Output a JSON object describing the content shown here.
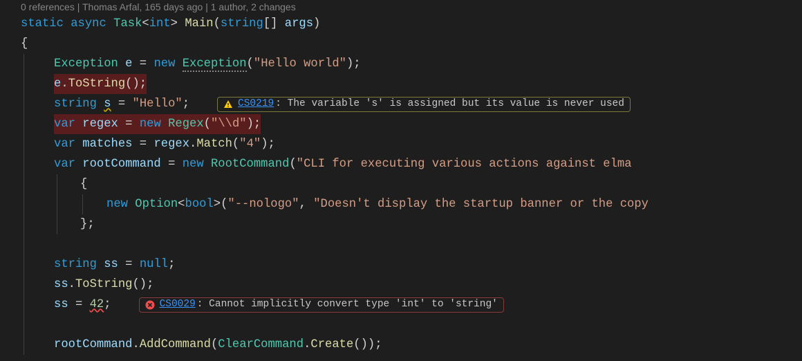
{
  "codelens": "0 references | Thomas Arfal, 165 days ago | 1 author, 2 changes",
  "sig": {
    "static": "static",
    "async": "async",
    "task": "Task",
    "lt": "<",
    "int": "int",
    "gt": ">",
    "sp": " ",
    "main": "Main",
    "op": "(",
    "string": "string",
    "br": "[] ",
    "args": "args",
    "cp": ")"
  },
  "openBrace": "{",
  "l1": {
    "type": "Exception",
    "v": "e",
    "eq": " = ",
    "new": "new",
    "ctor": "Exception",
    "op": "(",
    "str": "\"Hello world\"",
    "cp": ");"
  },
  "l2": {
    "v": "e",
    "dot": ".",
    "m": "ToString",
    "end": "();"
  },
  "l3": {
    "kw": "string",
    "v": "s",
    "eq": " = ",
    "str": "\"Hello\"",
    "end": ";"
  },
  "diag1": {
    "code": "CS0219",
    "msg": ": The variable 's' is assigned but its value is never used"
  },
  "l4": {
    "kw": "var",
    "v": "regex",
    "eq": " = ",
    "new": "new",
    "ctor": "Regex",
    "op": "(",
    "str": "\"\\\\d\"",
    "cp": ");"
  },
  "l5": {
    "kw": "var",
    "v": "matches",
    "eq": " = ",
    "obj": "regex",
    "dot": ".",
    "m": "Match",
    "op": "(",
    "str": "\"4\"",
    "cp": ");"
  },
  "l6": {
    "kw": "var",
    "v": "rootCommand",
    "eq": " = ",
    "new": "new",
    "ctor": "RootCommand",
    "op": "(",
    "str": "\"CLI for executing various actions against elma"
  },
  "l7": {
    "br": "{"
  },
  "l8": {
    "new": "new",
    "ctor": "Option",
    "lt": "<",
    "bool": "bool",
    "gt": ">(",
    "s1": "\"--nologo\"",
    "c": ", ",
    "s2": "\"Doesn't display the startup banner or the copy"
  },
  "l9": {
    "br": "};"
  },
  "l10": {
    "kw": "string",
    "v": "ss",
    "eq": " = ",
    "null": "null",
    "end": ";"
  },
  "l11": {
    "v": "ss",
    "dot": ".",
    "m": "ToString",
    "end": "();"
  },
  "l12": {
    "v": "ss",
    "eq": " = ",
    "num": "42",
    "end": ";"
  },
  "diag2": {
    "code": "CS0029",
    "msg": ": Cannot implicitly convert type 'int' to 'string'"
  },
  "l13": {
    "v": "rootCommand",
    "dot": ".",
    "m": "AddCommand",
    "op": "(",
    "t": "ClearCommand",
    "dot2": ".",
    "m2": "Create",
    "cp": "());"
  }
}
